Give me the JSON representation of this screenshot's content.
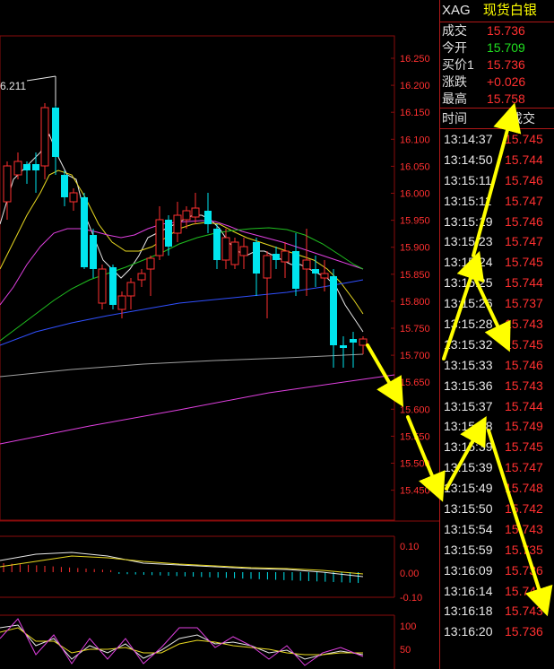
{
  "header": {
    "code": "XAG",
    "name": "现货白银"
  },
  "quote": [
    {
      "label": "成交",
      "value": "15.736",
      "color": "#ff3030"
    },
    {
      "label": "今开",
      "value": "15.709",
      "color": "#20e020"
    },
    {
      "label": "买价1",
      "value": "15.736",
      "color": "#ff3030"
    },
    {
      "label": "涨跌",
      "value": "+0.026",
      "color": "#ff3030"
    },
    {
      "label": "最高",
      "value": "15.758",
      "color": "#ff3030"
    }
  ],
  "ticks_header": {
    "time": "时间",
    "price": "成交"
  },
  "ticks": [
    {
      "time": "13:14:37",
      "price": "15.745"
    },
    {
      "time": "13:14:50",
      "price": "15.744"
    },
    {
      "time": "13:15:11",
      "price": "15.746"
    },
    {
      "time": "13:15:11",
      "price": "15.747"
    },
    {
      "time": "13:15:19",
      "price": "15.746"
    },
    {
      "time": "13:15:23",
      "price": "15.747"
    },
    {
      "time": "13:15:24",
      "price": "15.745"
    },
    {
      "time": "13:15:25",
      "price": "15.744"
    },
    {
      "time": "13:15:26",
      "price": "15.737"
    },
    {
      "time": "13:15:28",
      "price": "15.743"
    },
    {
      "time": "13:15:32",
      "price": "15.745"
    },
    {
      "time": "13:15:33",
      "price": "15.746"
    },
    {
      "time": "13:15:36",
      "price": "15.743"
    },
    {
      "time": "13:15:37",
      "price": "15.744"
    },
    {
      "time": "13:15:38",
      "price": "15.749"
    },
    {
      "time": "13:15:39",
      "price": "15.745"
    },
    {
      "time": "13:15:39",
      "price": "15.747"
    },
    {
      "time": "13:15:49",
      "price": "15.748"
    },
    {
      "time": "13:15:50",
      "price": "15.742"
    },
    {
      "time": "13:15:54",
      "price": "15.743"
    },
    {
      "time": "13:15:59",
      "price": "15.735"
    },
    {
      "time": "13:16:09",
      "price": "15.736"
    },
    {
      "time": "13:16:14",
      "price": "15.741"
    },
    {
      "time": "13:16:18",
      "price": "15.743"
    },
    {
      "time": "13:16:20",
      "price": "15.736"
    }
  ],
  "main_chart": {
    "high_label": "6.211",
    "y_ticks": [
      "16.250",
      "16.200",
      "16.150",
      "16.100",
      "16.050",
      "16.000",
      "15.950",
      "15.900",
      "15.850",
      "15.800",
      "15.750",
      "15.700",
      "15.650",
      "15.600",
      "15.550",
      "15.500",
      "15.450"
    ],
    "colors": {
      "up": "#ff3030",
      "down": "#00e5ee",
      "grid": "#8a0c0c",
      "axis_text": "#ff3030"
    }
  },
  "macd": {
    "y_ticks": [
      "0.10",
      "0.00",
      "-0.10"
    ]
  },
  "kdj": {
    "y_ticks": [
      "100",
      "50"
    ]
  }
}
